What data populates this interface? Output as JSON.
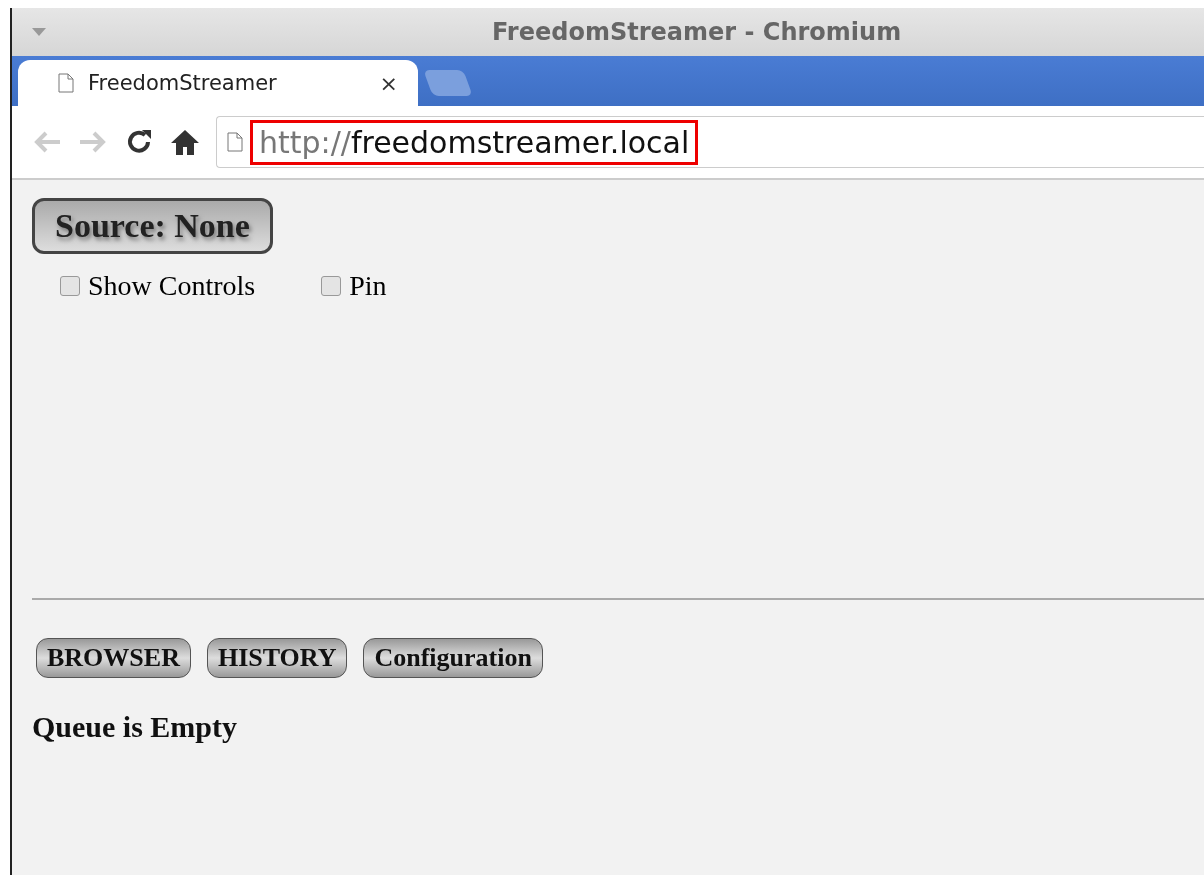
{
  "window": {
    "title": "FreedomStreamer - Chromium"
  },
  "tabs": [
    {
      "label": "FreedomStreamer",
      "close": "×",
      "selected": true
    }
  ],
  "address_bar": {
    "scheme": "http://",
    "host": "freedomstreamer.local",
    "highlighted": true
  },
  "source_button": {
    "label": "Source: None"
  },
  "options": [
    {
      "label": "Show Controls",
      "checked": false
    },
    {
      "label": "Pin",
      "checked": false
    }
  ],
  "nav_buttons": [
    "BROWSER",
    "HISTORY",
    "Configuration"
  ],
  "queue_status": "Queue is Empty"
}
